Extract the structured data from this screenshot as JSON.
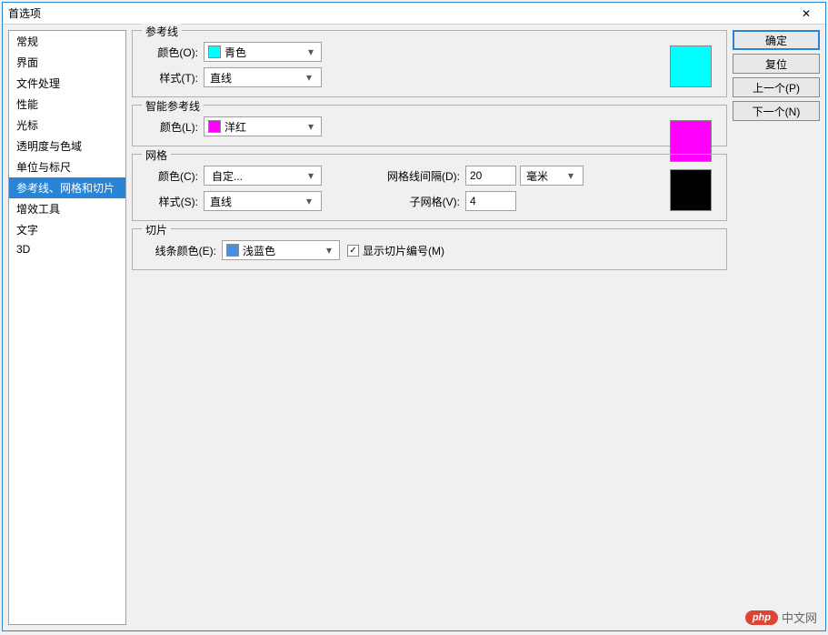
{
  "window": {
    "title": "首选项"
  },
  "sidebar": {
    "items": [
      {
        "label": "常规"
      },
      {
        "label": "界面"
      },
      {
        "label": "文件处理"
      },
      {
        "label": "性能"
      },
      {
        "label": "光标"
      },
      {
        "label": "透明度与色域"
      },
      {
        "label": "单位与标尺"
      },
      {
        "label": "参考线、网格和切片"
      },
      {
        "label": "增效工具"
      },
      {
        "label": "文字"
      },
      {
        "label": "3D"
      }
    ],
    "selected_index": 7
  },
  "guides": {
    "legend": "参考线",
    "color_label": "颜色(O):",
    "color_value": "青色",
    "color_hex": "#00FFFF",
    "style_label": "样式(T):",
    "style_value": "直线"
  },
  "smart_guides": {
    "legend": "智能参考线",
    "color_label": "颜色(L):",
    "color_value": "洋红",
    "color_hex": "#FF00FF"
  },
  "grid": {
    "legend": "网格",
    "color_label": "颜色(C):",
    "color_value": "自定...",
    "color_hex": "#000000",
    "style_label": "样式(S):",
    "style_value": "直线",
    "spacing_label": "网格线间隔(D):",
    "spacing_value": "20",
    "spacing_unit": "毫米",
    "subdiv_label": "子网格(V):",
    "subdiv_value": "4"
  },
  "slices": {
    "legend": "切片",
    "line_color_label": "线条颜色(E):",
    "line_color_value": "浅蓝色",
    "line_color_hex": "#4A90E2",
    "show_numbers_label": "显示切片编号(M)",
    "show_numbers_checked": true
  },
  "buttons": {
    "ok": "确定",
    "reset": "复位",
    "prev": "上一个(P)",
    "next": "下一个(N)"
  },
  "watermark": {
    "badge": "php",
    "text": "中文网"
  }
}
